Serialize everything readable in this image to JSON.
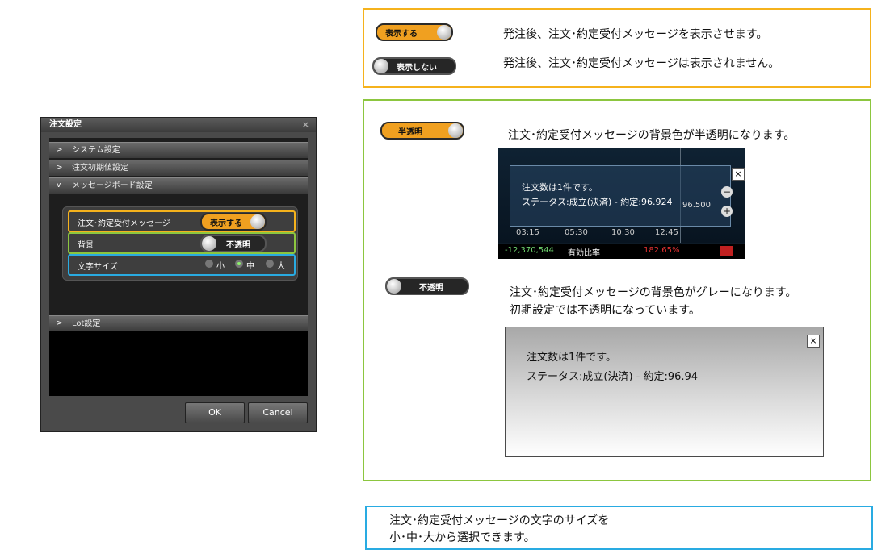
{
  "dialog": {
    "title": "注文設定",
    "close_glyph": "×",
    "sections": [
      {
        "label": "システム設定",
        "chevron": ">"
      },
      {
        "label": "注文初期値設定",
        "chevron": ">"
      },
      {
        "label": "メッセージボード設定",
        "chevron": "v"
      }
    ],
    "rows": {
      "confirm_label": "注文･約定受付メッセージ",
      "confirm_toggle": "表示する",
      "background_label": "背景",
      "background_toggle": "不透明",
      "fontsize_label": "文字サイズ",
      "fontsize_options": [
        "小",
        "中",
        "大"
      ],
      "fontsize_selected": "中"
    },
    "lot_section": {
      "label": "Lot設定",
      "chevron": ">"
    },
    "ok_label": "OK",
    "cancel_label": "Cancel"
  },
  "display_box": {
    "toggle_on_label": "表示する",
    "toggle_on_desc": "発注後、注文･約定受付メッセージを表示させます。",
    "toggle_off_label": "表示しない",
    "toggle_off_desc": "発注後、注文･約定受付メッセージは表示されません。"
  },
  "background_box": {
    "translucent_label": "半透明",
    "translucent_desc": "注文･約定受付メッセージの背景色が半透明になります。",
    "preview1": {
      "line1": "注文数は1件です。",
      "line2": "ステータス:成立(決済) - 約定:96.924",
      "price": "96.500",
      "times": [
        "03:15",
        "05:30",
        "10:30",
        "12:45"
      ],
      "bottom_value": "-12,370,544",
      "bottom_label": "有効比率",
      "bottom_pct": "182.65%"
    },
    "opaque_label": "不透明",
    "opaque_desc_line1": "注文･約定受付メッセージの背景色がグレーになります。",
    "opaque_desc_line2": "初期設定では不透明になっています。",
    "preview2": {
      "line1": "注文数は1件です。",
      "line2": "ステータス:成立(決済) - 約定:96.94"
    }
  },
  "fontsize_box": {
    "line1": "注文･約定受付メッセージの文字のサイズを",
    "line2": "小･中･大から選択できます。"
  },
  "colors": {
    "orange": "#f5b21c",
    "green": "#8cc63f",
    "blue": "#29abe2",
    "toggle_on": "#f0a020"
  }
}
